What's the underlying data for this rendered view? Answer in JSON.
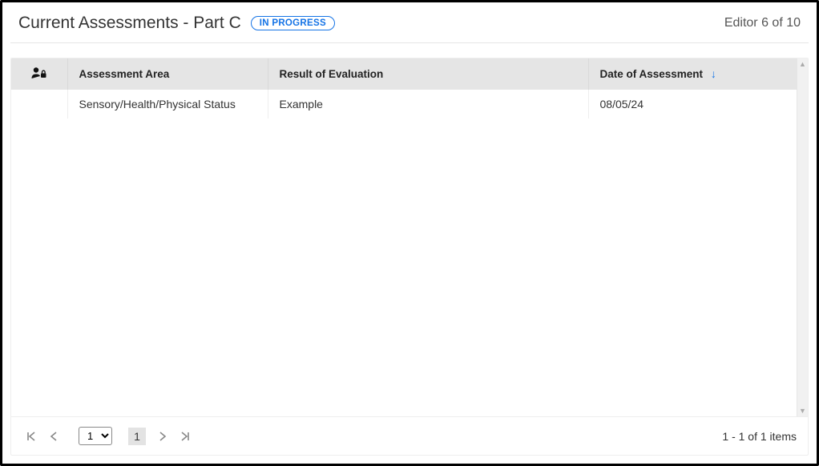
{
  "header": {
    "title": "Current Assessments - Part C",
    "status_badge": "IN PROGRESS",
    "editor_count": "Editor 6 of 10"
  },
  "table": {
    "columns": {
      "area": "Assessment Area",
      "result": "Result of Evaluation",
      "date": "Date of Assessment"
    },
    "sort": {
      "column": "date",
      "dir": "asc"
    },
    "rows": [
      {
        "area": "Sensory/Health/Physical Status",
        "result": "Example",
        "date": "08/05/24"
      }
    ]
  },
  "pager": {
    "select_value": "1",
    "page": "1",
    "info": "1 - 1 of 1 items"
  }
}
